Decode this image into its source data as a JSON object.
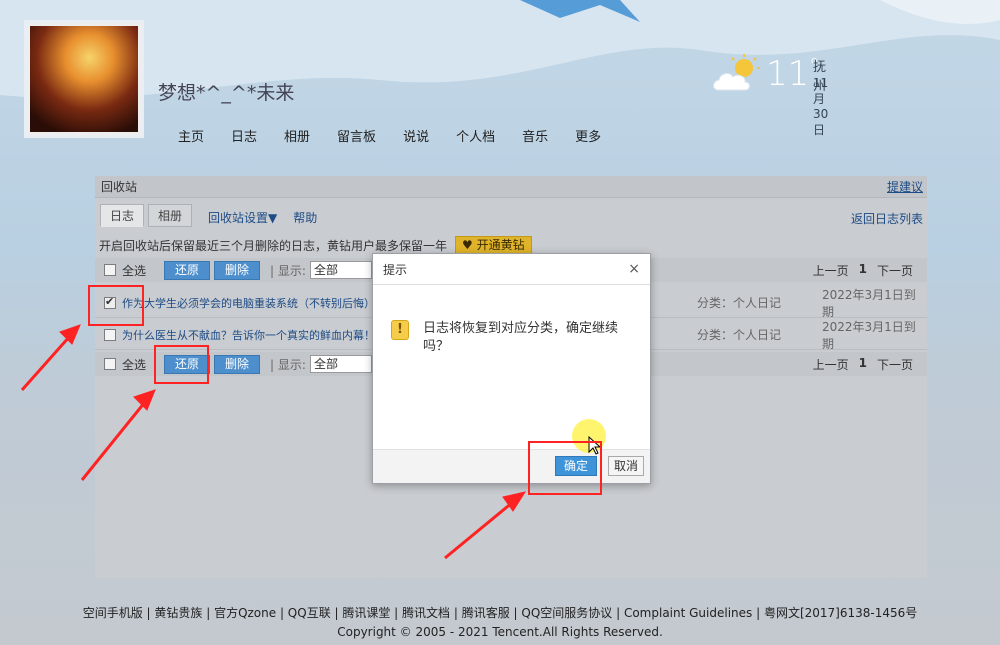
{
  "profile": {
    "username": "梦想*^_^*未来"
  },
  "nav": [
    "主页",
    "日志",
    "相册",
    "留言板",
    "说说",
    "个人档",
    "音乐",
    "更多"
  ],
  "weather": {
    "temp": "11",
    "degree": "°",
    "city": "抚州",
    "date": "11月30日"
  },
  "panel": {
    "title": "回收站",
    "suggest": "提建议",
    "tabs": [
      "日志",
      "相册"
    ],
    "settings": "回收站设置▼",
    "help": "帮助",
    "back": "返回日志列表",
    "notice": "开启回收站后保留最近三个月删除的日志，黄钻用户最多保留一年",
    "vip_button": "开通黄钻",
    "toolbar": {
      "select_all": "全选",
      "restore": "还原",
      "delete": "删除",
      "show_label": "| 显示:",
      "show_value": "全部",
      "prev": "上一页",
      "page": "1",
      "next": "下一页"
    },
    "rows": [
      {
        "checked": true,
        "title": "作为大学生必须学会的电脑重装系统（不转别后悔）",
        "category": "分类：个人日记",
        "expire": "2022年3月1日到期"
      },
      {
        "checked": false,
        "title": "为什么医生从不献血？告诉你一个真实的鲜血内幕！",
        "category": "分类：个人日记",
        "expire": "2022年3月1日到期"
      }
    ]
  },
  "dialog": {
    "title": "提示",
    "close": "×",
    "icon": "!",
    "message": "日志将恢复到对应分类，确定继续吗？",
    "ok": "确定",
    "cancel": "取消"
  },
  "footer": {
    "links": "空间手机版 | 黄钻贵族 | 官方Qzone | QQ互联 | 腾讯课堂 | 腾讯文档 | 腾讯客服 | QQ空间服务协议 | Complaint Guidelines | 粤网文[2017]6138-1456号",
    "copyright": "Copyright © 2005 - 2021 Tencent.All Rights Reserved."
  },
  "colors": {
    "accent": "#4d8fcc",
    "annotation": "#ff2222",
    "vip": "#e0b42a"
  }
}
